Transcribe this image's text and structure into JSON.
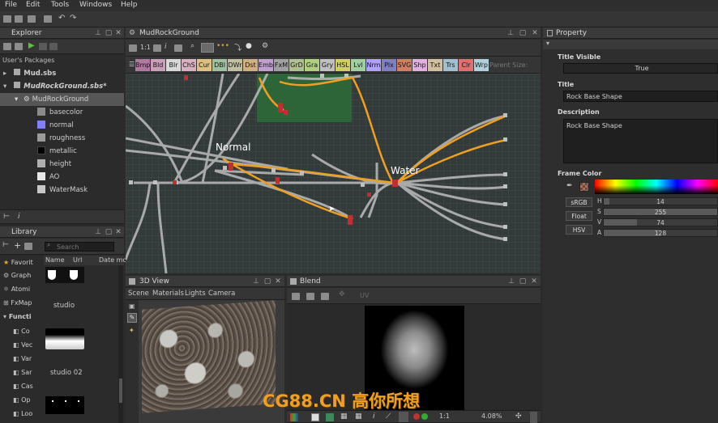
{
  "menu": [
    "File",
    "Edit",
    "Tools",
    "Windows",
    "Help"
  ],
  "explorer": {
    "title": "Explorer",
    "section": "User's Packages",
    "packages": [
      {
        "label": "Mud.sbs"
      },
      {
        "label": "MudRockGround.sbs*"
      }
    ],
    "graph": "MudRockGround",
    "outputs": [
      {
        "label": "basecolor",
        "color": "#8a8a8a"
      },
      {
        "label": "normal",
        "color": "#8080ff"
      },
      {
        "label": "roughness",
        "color": "#9a9a9a"
      },
      {
        "label": "metallic",
        "color": "#000000"
      },
      {
        "label": "height",
        "color": "#b0b0b0"
      },
      {
        "label": "AO",
        "color": "#e8e8e8"
      },
      {
        "label": "WaterMask",
        "color": "#c8c8c8"
      }
    ]
  },
  "library": {
    "title": "Library",
    "search_placeholder": "Search",
    "columns": [
      "Name",
      "Url",
      "Date mo"
    ],
    "categories": [
      "Favorit",
      "Graph",
      "Atomi",
      "FxMap",
      "Functi"
    ],
    "functions": [
      "Co",
      "Vec",
      "Var",
      "Sar",
      "Cas",
      "Op",
      "Loo"
    ],
    "thumbs": [
      "studio",
      "studio 02"
    ]
  },
  "graph": {
    "title": "MudRockGround",
    "zoom": "1:1",
    "node_tabs": [
      "Bmp",
      "Bld",
      "Blr",
      "ChS",
      "Cur",
      "DBl",
      "DWr",
      "Dst",
      "Emb",
      "FxM",
      "GrD",
      "Gra",
      "Gry",
      "HSL",
      "Lvl",
      "Nrm",
      "Plx",
      "SVG",
      "Shp",
      "Txt",
      "Trs",
      "Clr",
      "Wrp"
    ],
    "parent_size": "Parent Size:",
    "labels": {
      "normal": "Normal",
      "water": "Water"
    }
  },
  "view3d": {
    "title": "3D View",
    "menu": [
      "Scene",
      "Materials",
      "Lights",
      "Camera"
    ]
  },
  "blend": {
    "title": "Blend",
    "channel": "UV",
    "zoom_ratio": "1:1",
    "zoom": "4.08%"
  },
  "property": {
    "title": "Property",
    "title_visible_label": "Title Visible",
    "title_visible_value": "True",
    "title_label": "Title",
    "title_value": "Rock Base Shape",
    "description_label": "Description",
    "description_value": "Rock Base Shape",
    "frame_color_label": "Frame Color",
    "modes": [
      "sRGB",
      "Float",
      "HSV"
    ],
    "channels": [
      {
        "name": "H",
        "value": "14",
        "fraction": 0.05
      },
      {
        "name": "S",
        "value": "255",
        "fraction": 1.0
      },
      {
        "name": "V",
        "value": "74",
        "fraction": 0.29
      },
      {
        "name": "A",
        "value": "128",
        "fraction": 0.5
      }
    ]
  },
  "watermark": "CG88.CN 高你所想"
}
